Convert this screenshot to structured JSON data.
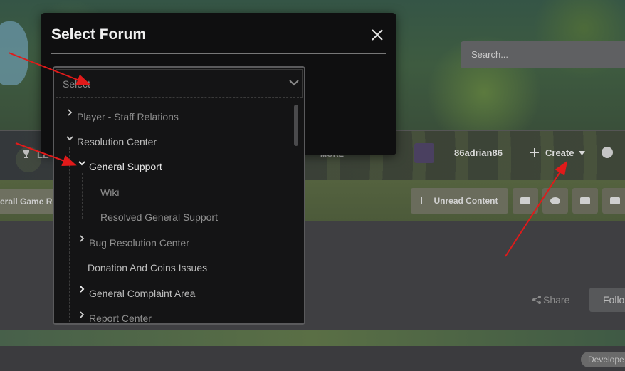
{
  "background": {
    "search_placeholder": "Search...",
    "nav_partial_left": "LE",
    "nav_more": "MORE",
    "username": "86adrian86",
    "create_label": "Create",
    "rules_partial": "erall Game Ru",
    "unread_label": "Unread Content",
    "share_label": "Share",
    "follow_partial": "Follo",
    "dev_badge": "Develope"
  },
  "modal": {
    "title": "Select Forum",
    "select_placeholder": "Select",
    "tree": [
      {
        "label": "Player - Staff Relations",
        "level": 0,
        "expanded": false
      },
      {
        "label": "Resolution Center",
        "level": 0,
        "expanded": true
      },
      {
        "label": "General Support",
        "level": 1,
        "expanded": true
      },
      {
        "label": "Wiki",
        "level": 2
      },
      {
        "label": "Resolved General Support",
        "level": 2
      },
      {
        "label": "Bug Resolution Center",
        "level": 1,
        "expanded": false
      },
      {
        "label": "Donation And Coins Issues",
        "level": 1
      },
      {
        "label": "General Complaint Area",
        "level": 1,
        "expanded": false
      },
      {
        "label": "Report Center",
        "level": 1,
        "expanded": false
      }
    ]
  },
  "colors": {
    "annotation_arrow": "#e11a1a",
    "modal_bg": "#0f0f10"
  },
  "icons": [
    "close-icon",
    "chevron-down-icon",
    "chevron-right-icon",
    "plus-icon",
    "globe-icon",
    "share-icon",
    "grid-icon"
  ]
}
